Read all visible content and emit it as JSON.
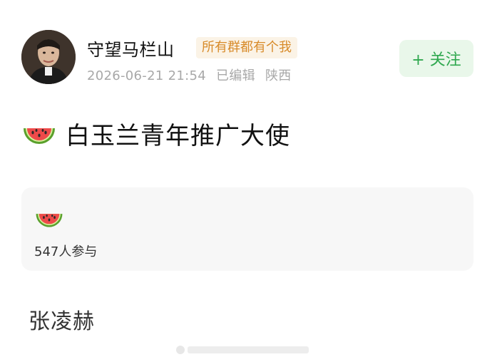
{
  "post": {
    "author_name": "守望马栏山",
    "group_badge": "所有群都有个我",
    "timestamp": "2026-06-21 21:54",
    "edited": "已编辑",
    "location": "陕西",
    "follow_label": "+ 关注",
    "title": "白玉兰青年推广大使"
  },
  "poll_card": {
    "participants": "547人参与"
  },
  "comment": {
    "text": "张凌赫"
  }
}
